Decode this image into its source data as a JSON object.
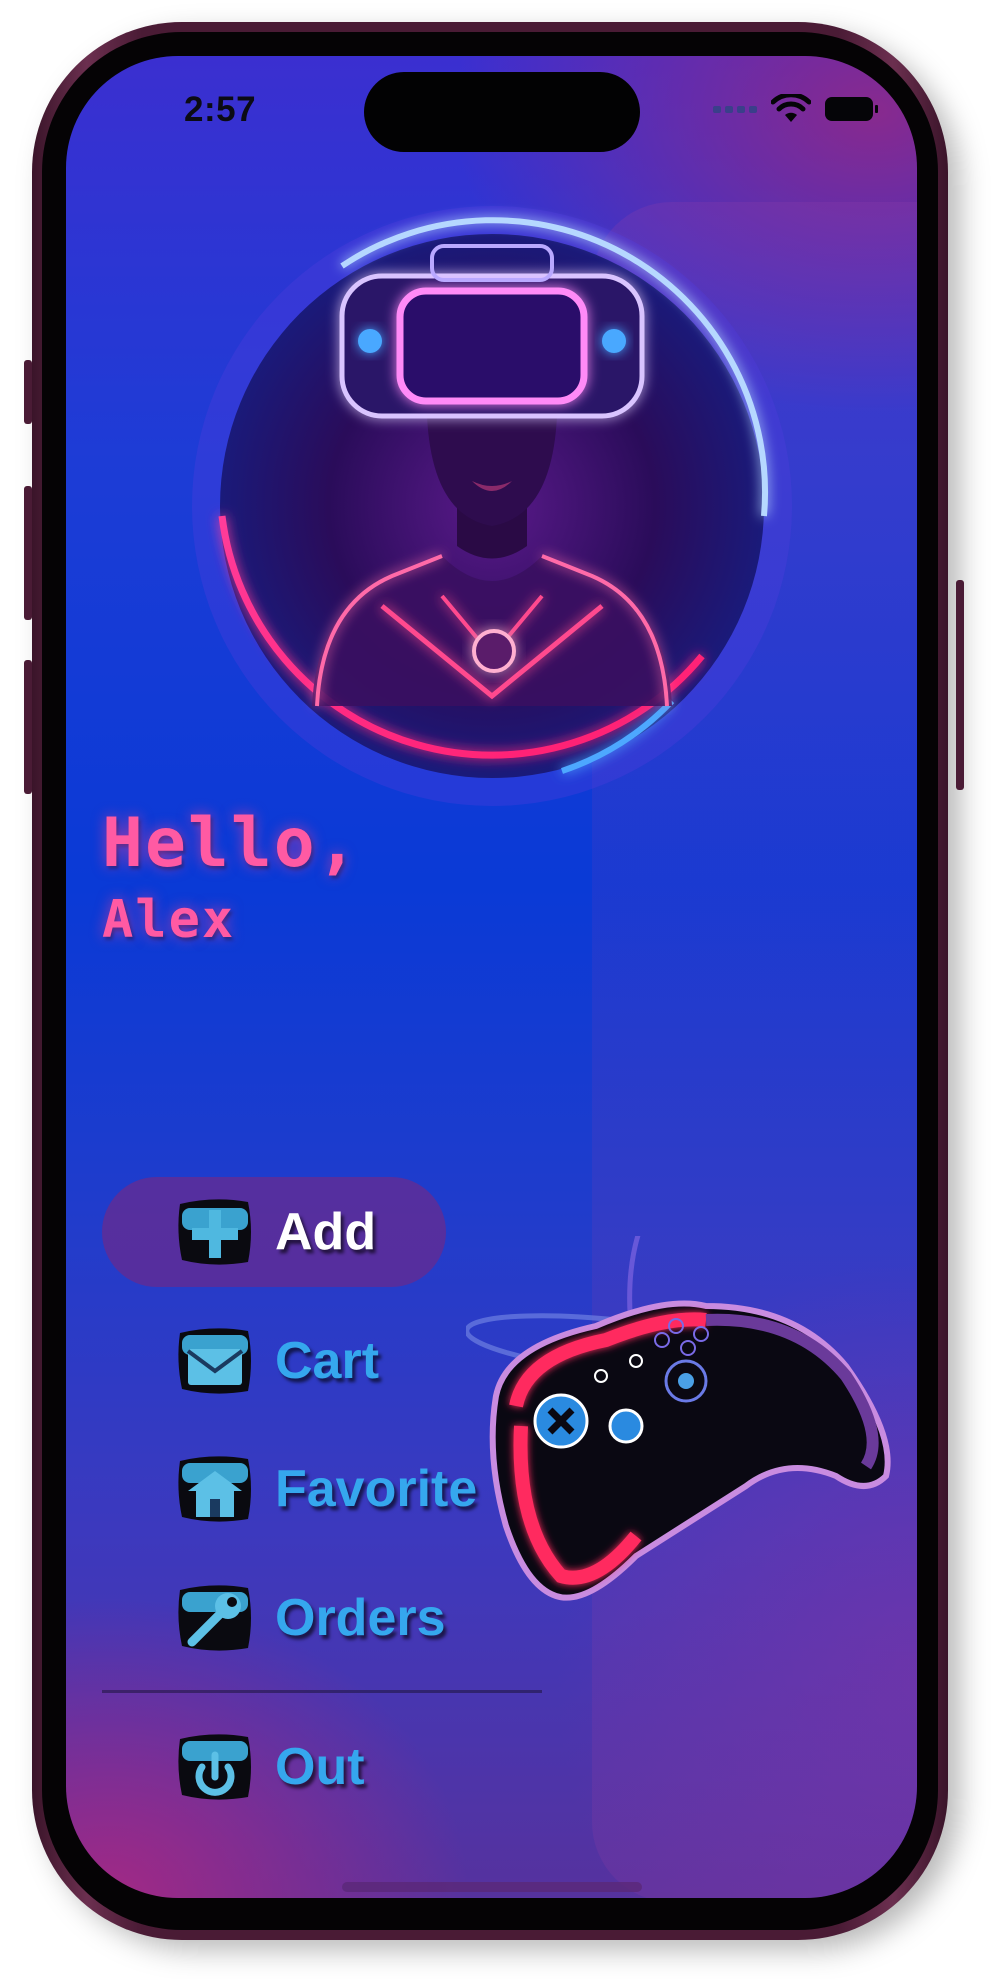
{
  "status_bar": {
    "time": "2:57"
  },
  "greeting": {
    "hello": "Hello,",
    "name": "Alex"
  },
  "menu": {
    "items": [
      {
        "label": "Add",
        "icon": "plus-icon",
        "active": true
      },
      {
        "label": "Cart",
        "icon": "envelope-icon",
        "active": false
      },
      {
        "label": "Favorite",
        "icon": "home-icon",
        "active": false
      },
      {
        "label": "Orders",
        "icon": "wrench-icon",
        "active": false
      },
      {
        "label": "Out",
        "icon": "power-icon",
        "active": false
      }
    ]
  },
  "illustrations": {
    "hero": "neon-vr-headset-person",
    "decor": "neon-game-controller"
  },
  "colors": {
    "accent_pink": "#ff5aa3",
    "menu_text": "#35a7ee",
    "active_pill": "#5f2d96",
    "active_text": "#ffffff"
  }
}
